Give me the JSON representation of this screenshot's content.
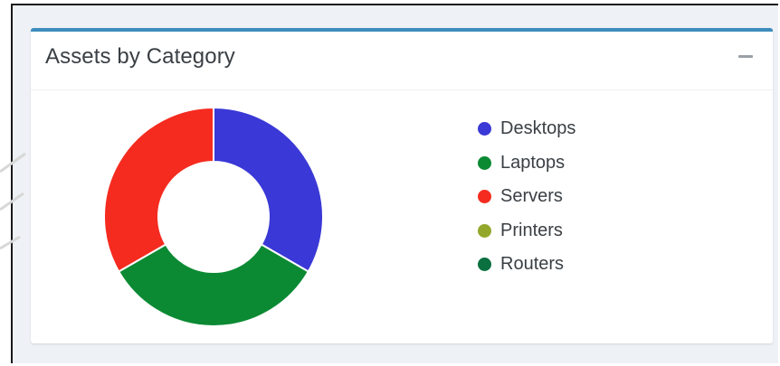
{
  "card": {
    "title": "Assets by Category",
    "collapse_icon": "minus-icon",
    "accent_color": "#3c8dbc"
  },
  "chart_data": {
    "type": "pie",
    "variant": "doughnut",
    "title": "Assets by Category",
    "legend_position": "right",
    "categories": [
      "Desktops",
      "Laptops",
      "Servers",
      "Printers",
      "Routers"
    ],
    "values": [
      1,
      1,
      1,
      0,
      0
    ],
    "colors": [
      "#3a38d6",
      "#0b8a33",
      "#f52b1f",
      "#93a82b",
      "#0b7040"
    ]
  }
}
